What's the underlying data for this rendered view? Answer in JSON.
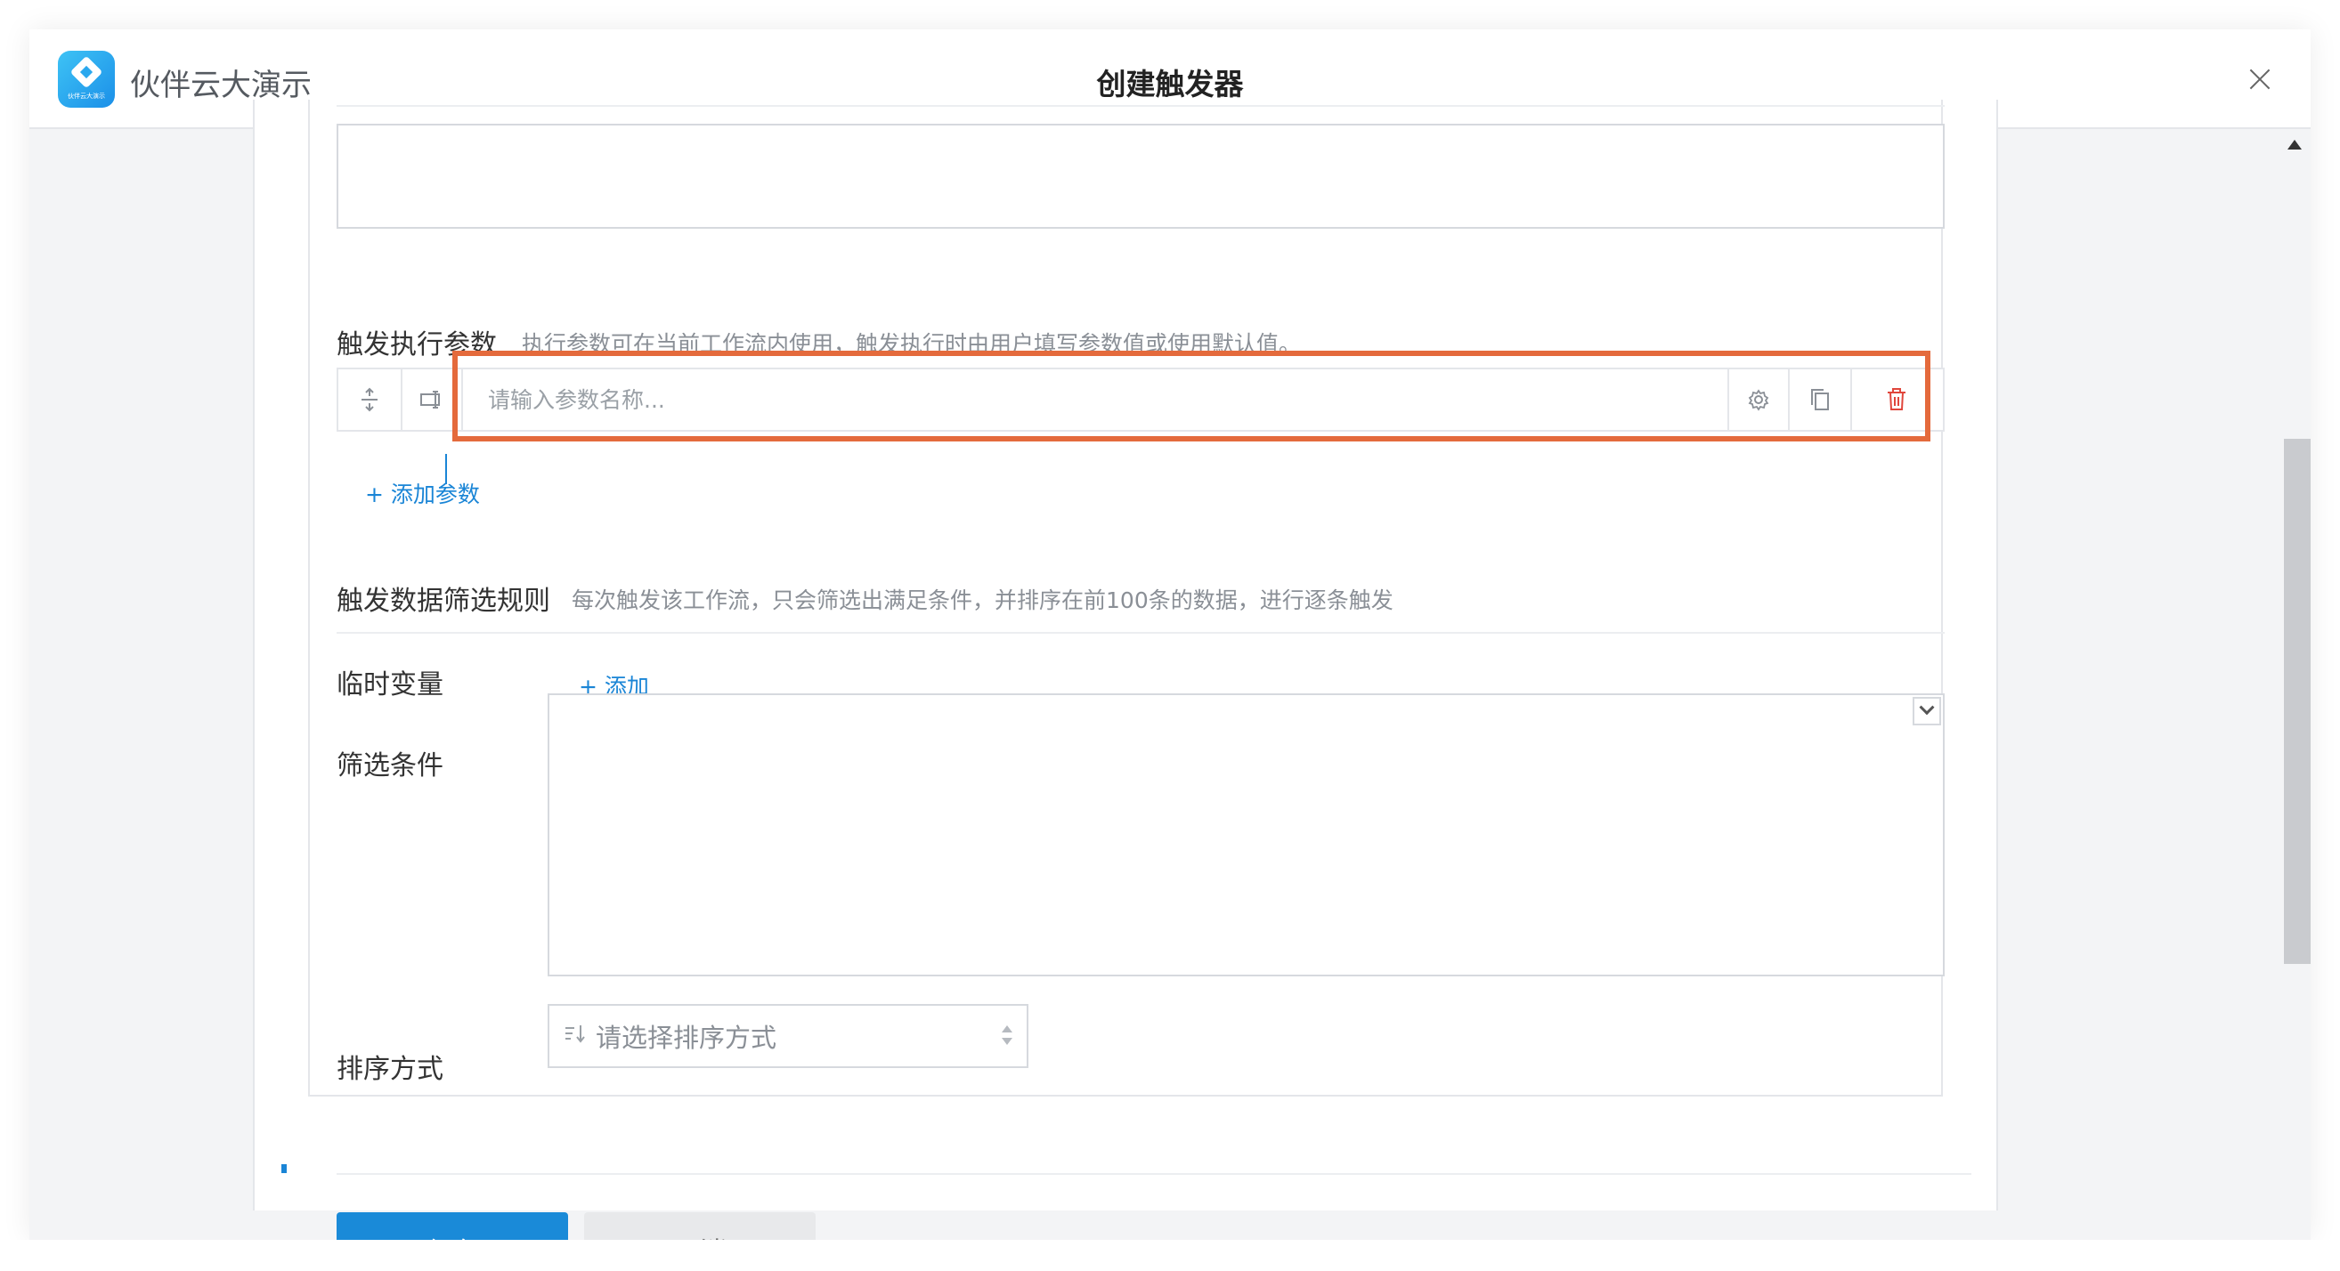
{
  "app": {
    "name": "伙伴云大演示",
    "logo_tiny_text": "伙伴云大演示"
  },
  "dialog": {
    "title": "创建触发器"
  },
  "trigger_params": {
    "title": "触发执行参数",
    "hint": "执行参数可在当前工作流内使用，触发执行时由用户填写参数值或使用默认值。",
    "input_placeholder": "请输入参数名称...",
    "add_label": "+ 添加参数",
    "highlight_color": "#e46a3c"
  },
  "filter_rules": {
    "title": "触发数据筛选规则",
    "hint": "每次触发该工作流，只会筛选出满足条件，并排序在前100条的数据，进行逐条触发",
    "temp_var_label": "临时变量",
    "temp_var_add": "+ 添加",
    "condition_label": "筛选条件",
    "sort_label": "排序方式",
    "sort_placeholder": "请选择排序方式"
  },
  "footer": {
    "save_label": "保存",
    "cancel_label": "取消"
  },
  "colors": {
    "accent": "#1a85d6",
    "primary_button": "#1a8ad8"
  }
}
